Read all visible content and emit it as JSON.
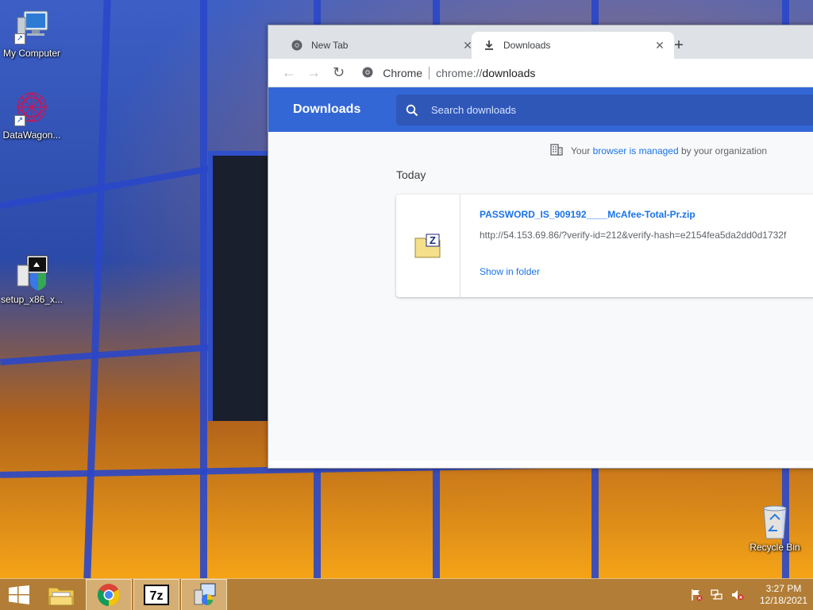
{
  "desktop": {
    "icons": [
      {
        "label": "My Computer"
      },
      {
        "label": "DataWagon..."
      },
      {
        "label": "setup_x86_x..."
      },
      {
        "label": "Recycle Bin"
      }
    ]
  },
  "browser": {
    "tabs": [
      {
        "title": "New Tab",
        "close": "✕"
      },
      {
        "title": "Downloads",
        "close": "✕"
      }
    ],
    "new_tab": "+",
    "omnibox": {
      "scheme_label": "Chrome",
      "url_prefix": "chrome://",
      "url_path": "downloads"
    },
    "nav": {
      "back": "←",
      "forward": "→",
      "reload": "↻"
    }
  },
  "downloads_page": {
    "title": "Downloads",
    "search_placeholder": "Search downloads",
    "managed_prefix": "Your ",
    "managed_link": "browser is managed",
    "managed_suffix": " by your organization",
    "date_group": "Today",
    "items": [
      {
        "file_name": "PASSWORD_IS_909192____McAfee-Total-Pr.zip",
        "url": "http://54.153.69.86/?verify-id=212&verify-hash=e2154fea5da2dd0d1732f",
        "action": "Show in folder",
        "icon": "7zip-archive-icon"
      }
    ]
  },
  "taskbar": {
    "items": [
      "windows-start-icon",
      "file-explorer-icon",
      "chrome-icon",
      "7zip-icon",
      "installer-icon"
    ],
    "clock": {
      "time": "3:27 PM",
      "date": "12/18/2021"
    }
  },
  "colors": {
    "header_blue": "#3367d6",
    "link_blue": "#1a73e8",
    "taskbar": "#bf822d"
  }
}
